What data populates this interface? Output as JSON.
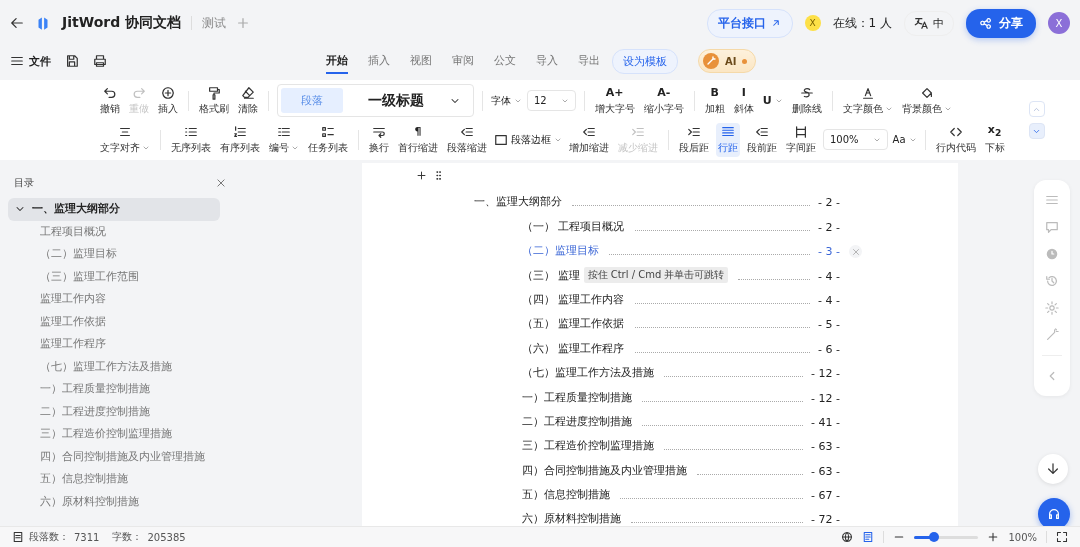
{
  "header": {
    "title": "JitWord 协同文档",
    "doc_tab": "测试",
    "api_button": "平台接口",
    "guest_avatar": "X",
    "online": "在线：1 人",
    "language": "中",
    "share_button": "分享",
    "user_avatar": "X"
  },
  "menu": {
    "file": "文件",
    "tabs": [
      {
        "label": "开始",
        "selected": true
      },
      {
        "label": "插入",
        "selected": false
      },
      {
        "label": "视图",
        "selected": false
      },
      {
        "label": "审阅",
        "selected": false
      },
      {
        "label": "公文",
        "selected": false
      },
      {
        "label": "导入",
        "selected": false
      },
      {
        "label": "导出",
        "selected": false
      }
    ],
    "template_button": "设为模板",
    "ai_button": "AI"
  },
  "toolbar": {
    "top_row": {
      "groups": [
        {
          "items": [
            {
              "kind": "button",
              "label": "撤销",
              "disabled": false,
              "active": false,
              "dropdown": false
            },
            {
              "kind": "button",
              "label": "重做",
              "disabled": true,
              "active": false,
              "dropdown": false
            },
            {
              "kind": "button",
              "label": "插入",
              "disabled": false,
              "active": false,
              "dropdown": false
            }
          ]
        },
        {
          "items": [
            {
              "kind": "button",
              "label": "格式刷",
              "disabled": false,
              "active": false,
              "dropdown": false
            },
            {
              "kind": "button",
              "label": "清除",
              "disabled": false,
              "active": false,
              "dropdown": false
            }
          ]
        },
        {
          "items": [
            {
              "kind": "style",
              "tag": "段落",
              "value": "一级标题"
            }
          ]
        },
        {
          "items": [
            {
              "kind": "dropdown",
              "label": "字体"
            },
            {
              "kind": "select",
              "value": "12"
            }
          ]
        },
        {
          "items": [
            {
              "kind": "button",
              "glyph": "A+",
              "label": "增大字号",
              "disabled": false,
              "active": false,
              "dropdown": false
            },
            {
              "kind": "button",
              "glyph": "A-",
              "label": "缩小字号",
              "disabled": false,
              "active": false,
              "dropdown": false
            }
          ]
        },
        {
          "items": [
            {
              "kind": "button",
              "glyph": "B",
              "label": "加粗",
              "disabled": false,
              "active": false,
              "dropdown": false
            },
            {
              "kind": "button",
              "glyph": "I",
              "label": "斜体",
              "disabled": false,
              "active": false,
              "dropdown": false
            },
            {
              "kind": "button",
              "glyph": "U",
              "disabled": false,
              "active": false,
              "dropdown": true
            },
            {
              "kind": "button",
              "label": "删除线",
              "disabled": false,
              "active": false,
              "dropdown": false
            }
          ]
        },
        {
          "items": [
            {
              "kind": "button",
              "label": "文字颜色",
              "disabled": false,
              "active": false,
              "dropdown": true
            },
            {
              "kind": "button",
              "label": "背景颜色",
              "disabled": false,
              "active": false,
              "dropdown": true
            }
          ]
        }
      ]
    },
    "bottom_row": {
      "groups": [
        {
          "items": [
            {
              "kind": "button",
              "label": "文字对齐",
              "disabled": false,
              "active": false,
              "dropdown": true
            }
          ]
        },
        {
          "items": [
            {
              "kind": "button",
              "label": "无序列表",
              "disabled": false,
              "active": false,
              "dropdown": false
            },
            {
              "kind": "button",
              "label": "有序列表",
              "disabled": false,
              "active": false,
              "dropdown": false
            },
            {
              "kind": "button",
              "label": "编号",
              "disabled": false,
              "active": false,
              "dropdown": true
            },
            {
              "kind": "button",
              "label": "任务列表",
              "disabled": false,
              "active": false,
              "dropdown": false
            }
          ]
        },
        {
          "items": [
            {
              "kind": "button",
              "label": "换行",
              "disabled": false,
              "active": false,
              "dropdown": false
            },
            {
              "kind": "button",
              "glyph": "¶",
              "label": "首行缩进",
              "disabled": false,
              "active": false,
              "dropdown": false
            },
            {
              "kind": "button",
              "label": "段落缩进",
              "disabled": false,
              "active": false,
              "dropdown": false
            },
            {
              "kind": "inline",
              "label": "段落边框"
            },
            {
              "kind": "button",
              "label": "增加缩进",
              "disabled": false,
              "active": false,
              "dropdown": false
            },
            {
              "kind": "button",
              "label": "减少缩进",
              "disabled": true,
              "active": false,
              "dropdown": false
            }
          ]
        },
        {
          "items": [
            {
              "kind": "button",
              "label": "段后距",
              "disabled": false,
              "active": false,
              "dropdown": false
            },
            {
              "kind": "button",
              "label": "行距",
              "disabled": false,
              "active": true,
              "dropdown": false
            },
            {
              "kind": "button",
              "label": "段前距",
              "disabled": false,
              "active": false,
              "dropdown": false
            },
            {
              "kind": "button",
              "label": "字间距",
              "disabled": false,
              "active": false,
              "dropdown": false
            },
            {
              "kind": "select",
              "value": "100%"
            },
            {
              "kind": "dropdown",
              "label": "Aa"
            }
          ]
        },
        {
          "items": [
            {
              "kind": "button",
              "label": "行内代码",
              "disabled": false,
              "active": false,
              "dropdown": false
            },
            {
              "kind": "button",
              "glyph": "x$_{2}$",
              "label": "下标",
              "disabled": false,
              "active": false,
              "dropdown": false
            }
          ]
        }
      ]
    }
  },
  "outline": {
    "title": "目录",
    "items": [
      {
        "label": "一、监理大纲部分",
        "expanded": true,
        "selected": true,
        "children": [
          {
            "label": "工程项目概况",
            "selected": false
          },
          {
            "label": "（二）监理目标",
            "selected": false
          },
          {
            "label": "（三）监理工作范围",
            "selected": false
          },
          {
            "label": "监理工作内容",
            "selected": false
          },
          {
            "label": "监理工作依据",
            "selected": false
          },
          {
            "label": "监理工作程序",
            "selected": false
          },
          {
            "label": "（七）监理工作方法及措施",
            "selected": false
          },
          {
            "label": "一）工程质量控制措施",
            "selected": false
          },
          {
            "label": "二）工程进度控制措施",
            "selected": false
          },
          {
            "label": "三）工程造价控制监理措施",
            "selected": false
          },
          {
            "label": "四）合同控制措施及内业管理措施",
            "selected": false
          },
          {
            "label": "五）信息控制措施",
            "selected": false
          },
          {
            "label": "六）原材料控制措施",
            "selected": false
          }
        ]
      }
    ]
  },
  "document": {
    "toc": [
      {
        "text": "一、监理大纲部分",
        "page": "- 2 -",
        "selected": false,
        "children": [
          {
            "text": "（一） 工程项目概况",
            "page": "- 2 -",
            "selected": false
          },
          {
            "text": "（二）监理目标",
            "page": "- 3 -",
            "selected": true
          },
          {
            "text": "（三） 监理",
            "page": "- 4 -",
            "selected": false,
            "tooltip": "按住 Ctrl / Cmd 并单击可跳转"
          },
          {
            "text": "（四） 监理工作内容",
            "page": "- 4 -",
            "selected": false
          },
          {
            "text": "（五） 监理工作依据",
            "page": "- 5 -",
            "selected": false
          },
          {
            "text": "（六） 监理工作程序",
            "page": "- 6 -",
            "selected": false
          },
          {
            "text": "（七）监理工作方法及措施",
            "page": "- 12 -",
            "selected": false
          },
          {
            "text": "一）工程质量控制措施",
            "page": "- 12 -",
            "selected": false
          },
          {
            "text": "二）工程进度控制措施",
            "page": "- 41 -",
            "selected": false
          },
          {
            "text": "三）工程造价控制监理措施",
            "page": "- 63 -",
            "selected": false
          },
          {
            "text": "四）合同控制措施及内业管理措施",
            "page": "- 63 -",
            "selected": false
          },
          {
            "text": "五）信息控制措施",
            "page": "- 67 -",
            "selected": false
          },
          {
            "text": "六）原材料控制措施",
            "page": "- 72 -",
            "selected": false
          }
        ]
      }
    ]
  },
  "status_bar": {
    "paragraphs_label": "段落数：",
    "paragraphs": "7311",
    "words_label": "字数：",
    "words": "205385",
    "zoom_slider": {
      "level": 0.3
    },
    "zoom": "100%"
  }
}
